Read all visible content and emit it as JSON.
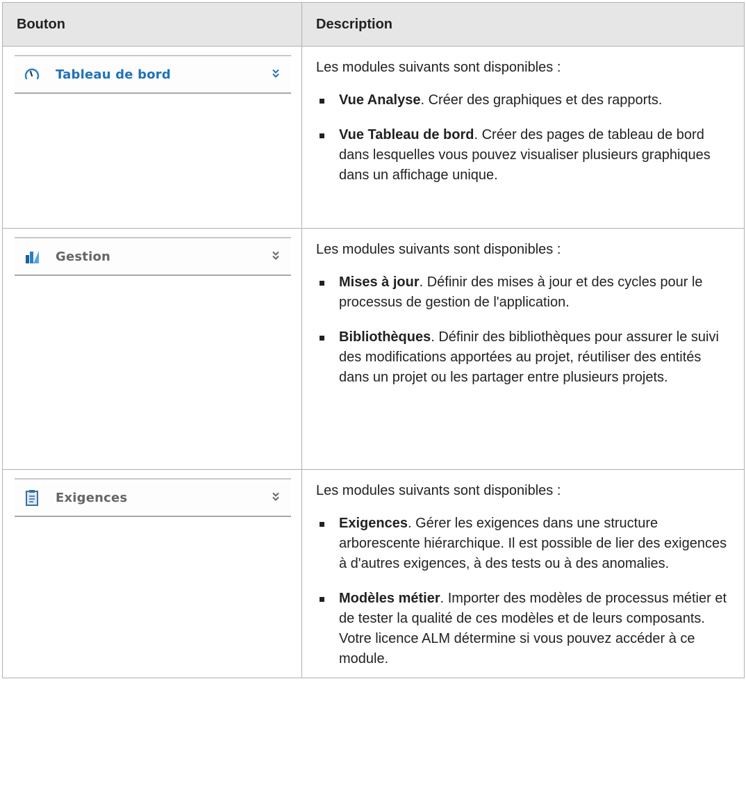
{
  "headers": {
    "button": "Bouton",
    "description": "Description"
  },
  "rows": [
    {
      "button_label": "Tableau de bord",
      "icon": "gauge-icon",
      "chevron": "»",
      "intro": "Les modules suivants sont disponibles :",
      "modules": [
        {
          "name": "Vue Analyse",
          "text": ". Créer des graphiques et des rapports."
        },
        {
          "name": "Vue Tableau de bord",
          "text": ". Créer des pages de tableau de bord dans lesquelles vous pouvez visualiser plusieurs graphiques dans un affichage unique."
        }
      ]
    },
    {
      "button_label": "Gestion",
      "icon": "bar-chart-icon",
      "chevron": "»",
      "intro": "Les modules suivants sont disponibles :",
      "modules": [
        {
          "name": "Mises à jour",
          "text": ". Définir des mises à jour et des cycles pour le processus de gestion de l'application."
        },
        {
          "name": "Bibliothèques",
          "text": ". Définir des bibliothèques pour assurer le suivi des modifications apportées au projet, réutiliser des entités dans un projet ou les partager entre plusieurs projets."
        }
      ]
    },
    {
      "button_label": "Exigences",
      "icon": "clipboard-icon",
      "chevron": "»",
      "intro": "Les modules suivants sont disponibles :",
      "modules": [
        {
          "name": "Exigences",
          "text": ". Gérer les exigences dans une structure arborescente hiérarchique. Il est possible de lier des exigences à d'autres exigences, à des tests ou à des anomalies."
        },
        {
          "name": "Modèles métier",
          "text": ". Importer des modèles de processus métier et de tester la qualité de ces modèles et de leurs composants. Votre licence ALM détermine si vous pouvez accéder à ce module."
        }
      ]
    }
  ],
  "colors": {
    "active_label": "#1f72b8",
    "inactive_label": "#666666",
    "header_bg": "#e6e6e6"
  }
}
